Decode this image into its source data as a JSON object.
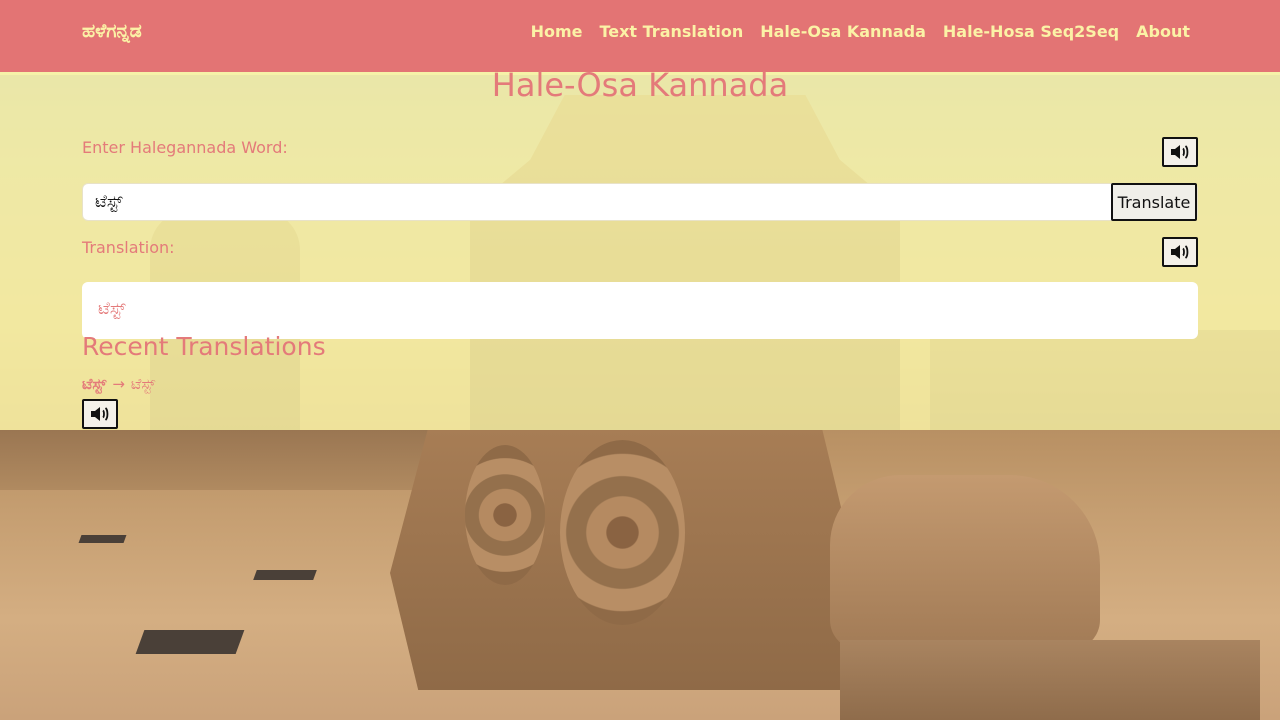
{
  "nav": {
    "brand": "ಹಳೆಗನ್ನಡ",
    "links": [
      "Home",
      "Text Translation",
      "Hale-Osa Kannada",
      "Hale-Hosa Seq2Seq",
      "About"
    ]
  },
  "page": {
    "title": "Hale-Osa Kannada",
    "input_label": "Enter Halegannada Word:",
    "input_value": "ಟೆಸ್ಟ್",
    "translate_label": "Translate",
    "output_label": "Translation:",
    "output_value": "ಟೆಸ್ಟ್",
    "recent_title": "Recent Translations",
    "recent": [
      {
        "source": "ಟೆಸ್ಟ್",
        "arrow": "→",
        "target": "ಟೆಸ್ಟ್"
      }
    ]
  },
  "icons": {
    "speaker": "speaker-icon"
  },
  "colors": {
    "navbar": "#e37474",
    "nav_text": "#fbf2a6",
    "accent_text": "#e47a7a",
    "overlay": "#faf5a5"
  }
}
